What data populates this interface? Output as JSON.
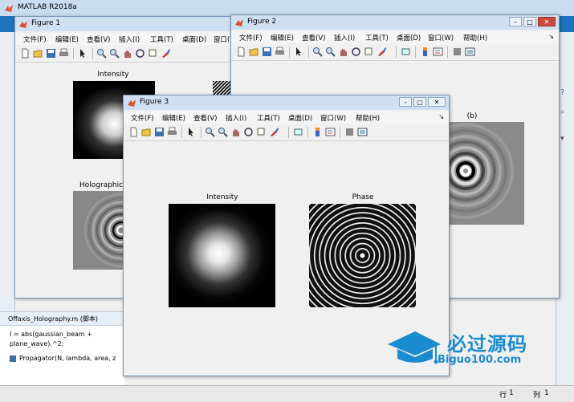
{
  "main_window": {
    "title": "MATLAB R2018a",
    "editor": {
      "file_label": "Offaxis_Holography.m  (脚本)",
      "code_line1": "I = abs(gaussian_beam +",
      "code_line2": "plane_wave).^2;",
      "function_label": "Propagator(N, lambda, area, z"
    },
    "status": {
      "row_label": "行",
      "row_value": "1",
      "col_label": "列",
      "col_value": "1"
    }
  },
  "menus": [
    "文件(F)",
    "编辑(E)",
    "查看(V)",
    "插入(I)",
    "工具(T)",
    "桌面(D)",
    "窗口(W)",
    "帮助(H)"
  ],
  "figures": {
    "figure1": {
      "title": "Figure 1",
      "plots": [
        {
          "title": "Intensity",
          "kind": "gaussian"
        },
        {
          "title": "Holographic",
          "kind": "fringes"
        }
      ]
    },
    "figure2": {
      "title": "Figure 2",
      "plots": [
        {
          "title": "(b)",
          "kind": "rings"
        }
      ]
    },
    "figure3": {
      "title": "Figure 3",
      "plots": [
        {
          "title": "Intensity",
          "kind": "gaussian"
        },
        {
          "title": "Phase",
          "kind": "phase"
        }
      ]
    }
  },
  "watermark": {
    "text_cn": "必过源码",
    "text_en": "Biguo100.com"
  },
  "colors": {
    "ribbon": "#1e73be",
    "titlebar": "#cfe0f2",
    "close_button": "#c94b3c",
    "watermark": "#1b8ad0"
  },
  "icons": [
    "new-icon",
    "open-icon",
    "save-icon",
    "print-icon",
    "pointer-icon",
    "zoom-in-icon",
    "zoom-out-icon",
    "pan-icon",
    "rotate-icon",
    "data-cursor-icon",
    "brush-icon",
    "link-icon",
    "colorbar-icon",
    "legend-icon",
    "hide-tools-icon",
    "dock-icon"
  ]
}
